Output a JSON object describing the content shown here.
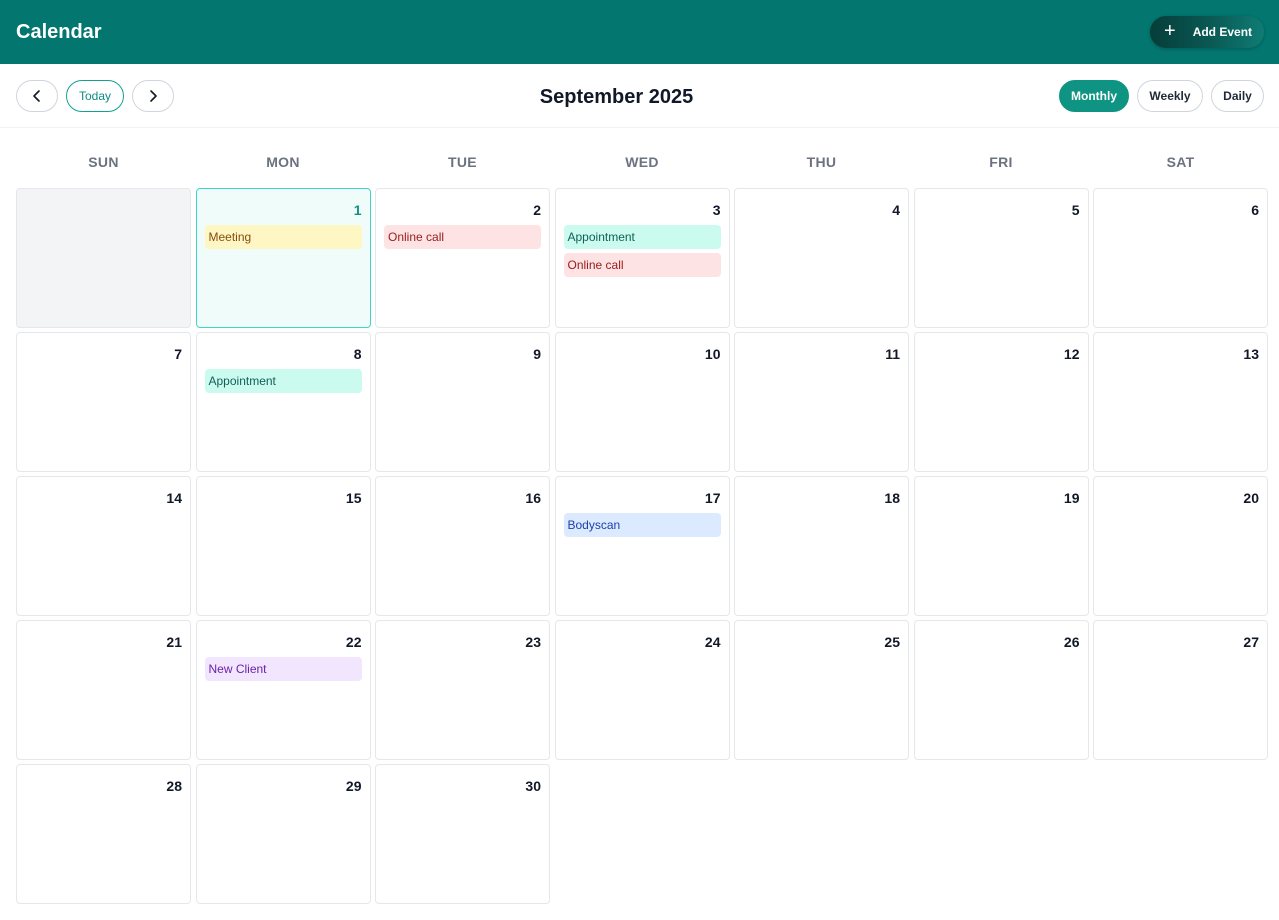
{
  "app": {
    "title": "Calendar",
    "add_event_label": "Add Event"
  },
  "toolbar": {
    "today_label": "Today",
    "month_title": "September 2025",
    "views": [
      "Monthly",
      "Weekly",
      "Daily"
    ],
    "active_view": "Monthly"
  },
  "weekdays": [
    "SUN",
    "MON",
    "TUE",
    "WED",
    "THU",
    "FRI",
    "SAT"
  ],
  "calendar": {
    "leading_empty_days": 1,
    "days_in_month": 30,
    "today": 1,
    "events": {
      "1": [
        {
          "title": "Meeting",
          "color": "yellow"
        }
      ],
      "2": [
        {
          "title": "Online call",
          "color": "red"
        }
      ],
      "3": [
        {
          "title": "Appointment",
          "color": "teal"
        },
        {
          "title": "Online call",
          "color": "red"
        }
      ],
      "8": [
        {
          "title": "Appointment",
          "color": "teal"
        }
      ],
      "17": [
        {
          "title": "Bodyscan",
          "color": "blue"
        }
      ],
      "22": [
        {
          "title": "New Client",
          "color": "purple"
        }
      ]
    }
  },
  "colors": {
    "header": "#03766f",
    "accent": "#0f9484",
    "yellow": "#fef6c3",
    "red": "#fde3e3",
    "teal": "#cbfbef",
    "blue": "#dbeafe",
    "purple": "#f1e6fd"
  },
  "icons": {
    "add": "plus-icon",
    "prev": "chevron-left-icon",
    "next": "chevron-right-icon"
  }
}
